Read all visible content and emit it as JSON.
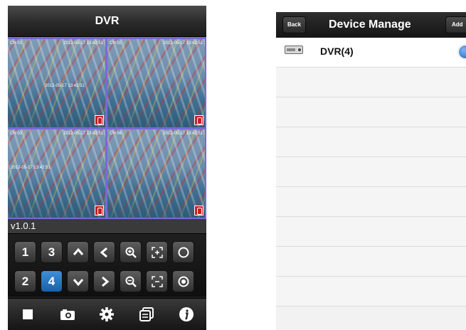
{
  "dvr": {
    "title": "DVR",
    "cameras": [
      {
        "label": "CH 01",
        "time": "2012-05-17 13:42:51",
        "overlay_time": "2012-05-17 13:42:51"
      },
      {
        "label": "CH 02",
        "time": "2012-05-17 13:42:51",
        "overlay_time": ""
      },
      {
        "label": "CH 03",
        "time": "2012-05-17 13:42:51",
        "overlay_time": "2012-05-17 13:42:51"
      },
      {
        "label": "CH 04",
        "time": "2012-05-17 13:42:51",
        "overlay_time": ""
      }
    ],
    "version": "v1.0.1",
    "channel_buttons": [
      "1",
      "3",
      "2",
      "4"
    ],
    "selected_channel": "4",
    "accent_color": "#2a73c0"
  },
  "device_manage": {
    "title": "Device Manage",
    "back_label": "Back",
    "add_label": "Add",
    "devices": [
      {
        "name": "DVR(4)"
      }
    ]
  }
}
